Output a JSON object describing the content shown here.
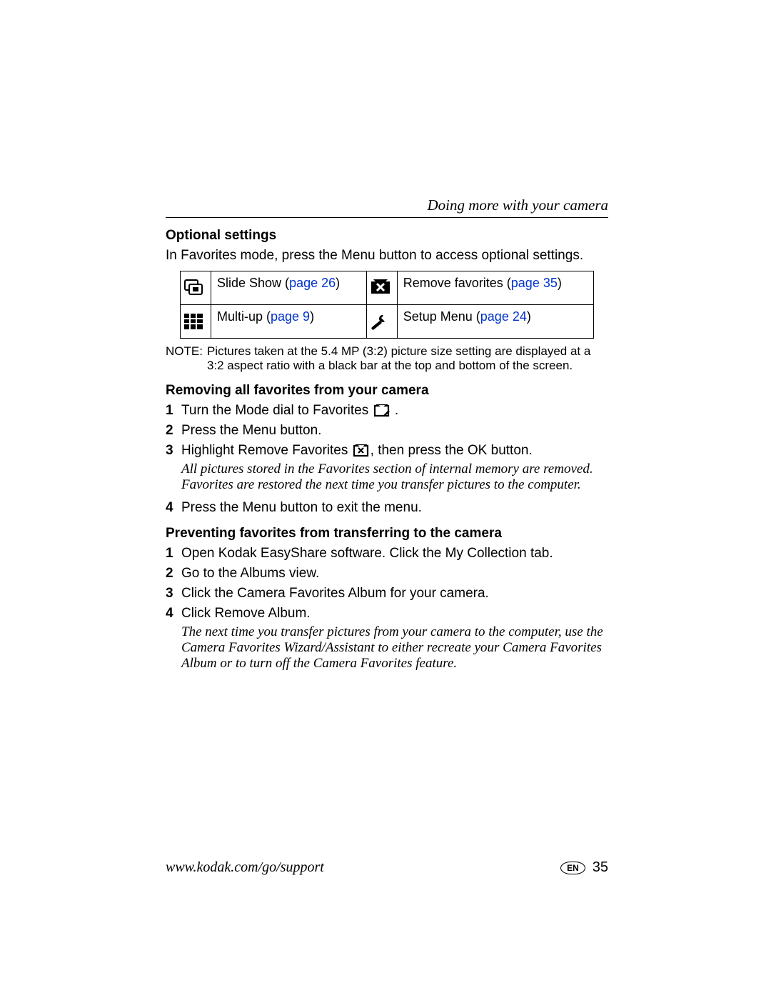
{
  "header": {
    "section_title": "Doing more with your camera"
  },
  "optional": {
    "heading": "Optional settings",
    "intro": "In Favorites mode, press the Menu button to access optional settings.",
    "table": {
      "r1c1": {
        "label": "Slide Show (",
        "link": "page 26",
        "after": ")"
      },
      "r1c2": {
        "label": "Remove favorites (",
        "link": "page 35",
        "after": ")"
      },
      "r2c1": {
        "label": "Multi-up (",
        "link": "page 9",
        "after": ")"
      },
      "r2c2": {
        "label": "Setup Menu (",
        "link": "page 24",
        "after": ")"
      }
    },
    "note_label": "NOTE:",
    "note_body": "Pictures taken at the 5.4 MP (3:2) picture size setting are displayed at a 3:2 aspect ratio with a black bar at the top and bottom of the screen."
  },
  "removing": {
    "heading": "Removing all favorites from your camera",
    "step1_pre": "Turn the Mode dial to Favorites ",
    "step1_post": " .",
    "step2": "Press the Menu button.",
    "step3_pre": "Highlight Remove Favorites ",
    "step3_post": ", then press the OK button.",
    "result": "All pictures stored in the Favorites section of internal memory are removed. Favorites are restored the next time you transfer pictures to the computer.",
    "step4": "Press the Menu button to exit the menu."
  },
  "preventing": {
    "heading": "Preventing favorites from transferring to the camera",
    "step1": "Open Kodak EasyShare software. Click the My Collection tab.",
    "step2": "Go to the Albums view.",
    "step3": "Click the Camera Favorites Album for your camera.",
    "step4": "Click Remove Album.",
    "result": "The next time you transfer pictures from your camera to the computer, use the Camera Favorites Wizard/Assistant to either recreate your Camera Favorites Album or to turn off the Camera Favorites feature."
  },
  "footer": {
    "url": "www.kodak.com/go/support",
    "lang": "EN",
    "page": "35"
  }
}
